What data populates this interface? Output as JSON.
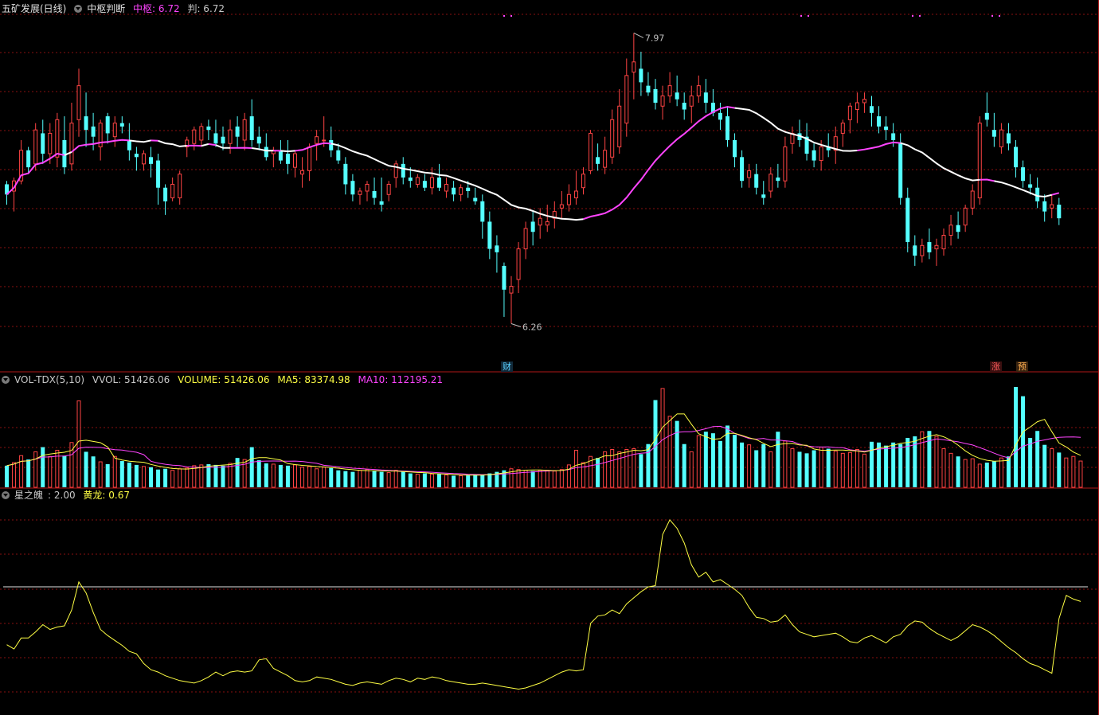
{
  "panel_price": {
    "title": "五矿发展(日线)",
    "indicator": "中枢判断",
    "mid_label": "中枢: 6.72",
    "judge_label": "判: 6.72",
    "high_label": "7.97",
    "low_label": "6.26",
    "markers": [
      "财",
      "涨",
      "预"
    ]
  },
  "panel_volume": {
    "name": "VOL-TDX(5,10)",
    "vvol": "VVOL: 51426.06",
    "volume": "VOLUME: 51426.06",
    "ma5": "MA5: 83374.98",
    "ma10": "MA10: 112195.21"
  },
  "panel_osc": {
    "name": "星之魄",
    "value": ": 2.00",
    "yellow_label": "黄龙: 0.67"
  },
  "colors": {
    "up": "#ff4444",
    "down": "#54ffff",
    "ma_white": "#ffffff",
    "ma_magenta": "#ff44ff",
    "ma_yellow": "#ffff44",
    "grid": "#8a1010"
  },
  "chart_data": [
    {
      "type": "candlestick",
      "title": "五矿发展(日线)",
      "yrange": [
        6.0,
        8.08
      ],
      "high": 7.97,
      "low": 6.26,
      "candles": [
        [
          7.08,
          7.1,
          6.96,
          7.02
        ],
        [
          7.04,
          7.12,
          6.92,
          7.1
        ],
        [
          7.1,
          7.34,
          7.08,
          7.28
        ],
        [
          7.28,
          7.3,
          7.14,
          7.18
        ],
        [
          7.2,
          7.44,
          7.16,
          7.4
        ],
        [
          7.38,
          7.46,
          7.2,
          7.26
        ],
        [
          7.26,
          7.44,
          7.2,
          7.38
        ],
        [
          7.24,
          7.5,
          7.18,
          7.46
        ],
        [
          7.34,
          7.48,
          7.14,
          7.18
        ],
        [
          7.2,
          7.56,
          7.16,
          7.44
        ],
        [
          7.46,
          7.76,
          7.36,
          7.66
        ],
        [
          7.48,
          7.62,
          7.3,
          7.4
        ],
        [
          7.42,
          7.5,
          7.28,
          7.36
        ],
        [
          7.3,
          7.46,
          7.22,
          7.44
        ],
        [
          7.48,
          7.5,
          7.32,
          7.38
        ],
        [
          7.36,
          7.48,
          7.3,
          7.44
        ],
        [
          7.44,
          7.48,
          7.38,
          7.42
        ],
        [
          7.34,
          7.44,
          7.22,
          7.28
        ],
        [
          7.26,
          7.3,
          7.16,
          7.24
        ],
        [
          7.2,
          7.28,
          7.16,
          7.26
        ],
        [
          7.24,
          7.3,
          7.12,
          7.2
        ],
        [
          7.22,
          7.26,
          6.96,
          7.06
        ],
        [
          7.06,
          7.08,
          6.9,
          6.98
        ],
        [
          7.0,
          7.12,
          6.98,
          7.08
        ],
        [
          7.0,
          7.16,
          6.96,
          7.14
        ],
        [
          7.3,
          7.36,
          7.24,
          7.34
        ],
        [
          7.32,
          7.42,
          7.28,
          7.4
        ],
        [
          7.34,
          7.44,
          7.3,
          7.42
        ],
        [
          7.42,
          7.46,
          7.34,
          7.4
        ],
        [
          7.38,
          7.46,
          7.3,
          7.32
        ],
        [
          7.36,
          7.42,
          7.28,
          7.32
        ],
        [
          7.32,
          7.46,
          7.26,
          7.4
        ],
        [
          7.42,
          7.48,
          7.3,
          7.36
        ],
        [
          7.34,
          7.5,
          7.28,
          7.46
        ],
        [
          7.48,
          7.58,
          7.3,
          7.34
        ],
        [
          7.36,
          7.42,
          7.28,
          7.32
        ],
        [
          7.3,
          7.38,
          7.22,
          7.24
        ],
        [
          7.26,
          7.3,
          7.18,
          7.28
        ],
        [
          7.28,
          7.34,
          7.2,
          7.22
        ],
        [
          7.26,
          7.34,
          7.14,
          7.2
        ],
        [
          7.18,
          7.28,
          7.12,
          7.26
        ],
        [
          7.14,
          7.24,
          7.06,
          7.16
        ],
        [
          7.16,
          7.32,
          7.1,
          7.3
        ],
        [
          7.32,
          7.4,
          7.22,
          7.36
        ],
        [
          7.34,
          7.48,
          7.3,
          7.34
        ],
        [
          7.34,
          7.42,
          7.24,
          7.28
        ],
        [
          7.28,
          7.32,
          7.2,
          7.22
        ],
        [
          7.2,
          7.24,
          7.02,
          7.08
        ],
        [
          7.1,
          7.14,
          6.98,
          7.02
        ],
        [
          7.02,
          7.06,
          6.96,
          7.04
        ],
        [
          7.04,
          7.1,
          6.98,
          7.08
        ],
        [
          7.04,
          7.12,
          6.96,
          7.0
        ],
        [
          6.98,
          7.12,
          6.92,
          6.96
        ],
        [
          7.02,
          7.1,
          6.98,
          7.08
        ],
        [
          7.12,
          7.22,
          7.06,
          7.2
        ],
        [
          7.2,
          7.24,
          7.08,
          7.12
        ],
        [
          7.12,
          7.18,
          7.06,
          7.1
        ],
        [
          7.08,
          7.14,
          7.06,
          7.12
        ],
        [
          7.1,
          7.14,
          7.04,
          7.06
        ],
        [
          7.06,
          7.18,
          7.02,
          7.12
        ],
        [
          7.12,
          7.2,
          7.04,
          7.06
        ],
        [
          7.04,
          7.12,
          7.0,
          7.08
        ],
        [
          7.06,
          7.1,
          6.98,
          7.02
        ],
        [
          7.02,
          7.08,
          6.98,
          7.06
        ],
        [
          7.06,
          7.1,
          7.0,
          7.04
        ],
        [
          7.0,
          7.06,
          6.96,
          6.98
        ],
        [
          6.98,
          7.02,
          6.76,
          6.86
        ],
        [
          6.86,
          6.92,
          6.64,
          6.7
        ],
        [
          6.72,
          6.78,
          6.56,
          6.68
        ],
        [
          6.6,
          6.62,
          6.3,
          6.46
        ],
        [
          6.44,
          6.54,
          6.26,
          6.48
        ],
        [
          6.52,
          6.74,
          6.44,
          6.7
        ],
        [
          6.7,
          6.86,
          6.64,
          6.82
        ],
        [
          6.86,
          6.92,
          6.72,
          6.8
        ],
        [
          6.84,
          6.94,
          6.76,
          6.88
        ],
        [
          6.84,
          6.96,
          6.8,
          6.86
        ],
        [
          6.88,
          6.98,
          6.82,
          6.92
        ],
        [
          6.94,
          7.04,
          6.88,
          6.96
        ],
        [
          6.96,
          7.08,
          6.92,
          7.02
        ],
        [
          7.0,
          7.16,
          6.96,
          7.04
        ],
        [
          7.06,
          7.18,
          7.02,
          7.14
        ],
        [
          7.16,
          7.4,
          7.14,
          7.38
        ],
        [
          7.24,
          7.32,
          7.16,
          7.2
        ],
        [
          7.18,
          7.36,
          7.14,
          7.28
        ],
        [
          7.24,
          7.52,
          7.2,
          7.46
        ],
        [
          7.3,
          7.64,
          7.26,
          7.54
        ],
        [
          7.44,
          7.82,
          7.36,
          7.72
        ],
        [
          7.74,
          7.97,
          7.58,
          7.8
        ],
        [
          7.76,
          7.86,
          7.6,
          7.68
        ],
        [
          7.66,
          7.74,
          7.6,
          7.62
        ],
        [
          7.64,
          7.7,
          7.52,
          7.56
        ],
        [
          7.54,
          7.66,
          7.46,
          7.6
        ],
        [
          7.6,
          7.74,
          7.56,
          7.66
        ],
        [
          7.62,
          7.72,
          7.54,
          7.58
        ],
        [
          7.56,
          7.62,
          7.46,
          7.52
        ],
        [
          7.54,
          7.66,
          7.44,
          7.6
        ],
        [
          7.6,
          7.72,
          7.56,
          7.66
        ],
        [
          7.62,
          7.7,
          7.5,
          7.56
        ],
        [
          7.56,
          7.64,
          7.48,
          7.5
        ],
        [
          7.5,
          7.56,
          7.4,
          7.46
        ],
        [
          7.48,
          7.54,
          7.3,
          7.34
        ],
        [
          7.34,
          7.38,
          7.18,
          7.24
        ],
        [
          7.24,
          7.28,
          7.06,
          7.1
        ],
        [
          7.12,
          7.2,
          7.06,
          7.16
        ],
        [
          7.14,
          7.2,
          7.02,
          7.06
        ],
        [
          7.02,
          7.1,
          6.96,
          7.0
        ],
        [
          7.04,
          7.18,
          7.0,
          7.14
        ],
        [
          7.12,
          7.2,
          7.06,
          7.1
        ],
        [
          7.1,
          7.36,
          7.06,
          7.3
        ],
        [
          7.32,
          7.42,
          7.26,
          7.38
        ],
        [
          7.38,
          7.46,
          7.3,
          7.34
        ],
        [
          7.36,
          7.44,
          7.22,
          7.26
        ],
        [
          7.28,
          7.32,
          7.18,
          7.22
        ],
        [
          7.22,
          7.34,
          7.16,
          7.3
        ],
        [
          7.3,
          7.38,
          7.24,
          7.28
        ],
        [
          7.28,
          7.42,
          7.2,
          7.36
        ],
        [
          7.38,
          7.46,
          7.3,
          7.44
        ],
        [
          7.46,
          7.56,
          7.38,
          7.54
        ],
        [
          7.52,
          7.62,
          7.44,
          7.56
        ],
        [
          7.56,
          7.62,
          7.5,
          7.58
        ],
        [
          7.54,
          7.6,
          7.42,
          7.5
        ],
        [
          7.48,
          7.54,
          7.38,
          7.42
        ],
        [
          7.42,
          7.48,
          7.34,
          7.4
        ],
        [
          7.38,
          7.44,
          7.3,
          7.34
        ],
        [
          7.32,
          7.38,
          6.96,
          7.0
        ],
        [
          7.0,
          7.06,
          6.68,
          6.74
        ],
        [
          6.72,
          6.78,
          6.6,
          6.66
        ],
        [
          6.66,
          6.76,
          6.62,
          6.72
        ],
        [
          6.74,
          6.82,
          6.64,
          6.68
        ],
        [
          6.7,
          6.76,
          6.6,
          6.72
        ],
        [
          6.7,
          6.82,
          6.66,
          6.78
        ],
        [
          6.78,
          6.9,
          6.72,
          6.84
        ],
        [
          6.84,
          6.92,
          6.76,
          6.8
        ],
        [
          6.84,
          6.96,
          6.8,
          6.94
        ],
        [
          6.94,
          7.08,
          6.9,
          7.04
        ],
        [
          7.0,
          7.48,
          6.96,
          7.44
        ],
        [
          7.5,
          7.62,
          7.42,
          7.46
        ],
        [
          7.4,
          7.5,
          7.3,
          7.36
        ],
        [
          7.3,
          7.44,
          7.26,
          7.4
        ],
        [
          7.38,
          7.44,
          7.28,
          7.32
        ],
        [
          7.3,
          7.34,
          7.12,
          7.18
        ],
        [
          7.18,
          7.22,
          7.06,
          7.1
        ],
        [
          7.08,
          7.14,
          7.02,
          7.06
        ],
        [
          7.06,
          7.12,
          6.94,
          6.98
        ],
        [
          6.98,
          7.02,
          6.86,
          6.92
        ],
        [
          6.94,
          7.02,
          6.88,
          6.96
        ],
        [
          6.96,
          7.0,
          6.84,
          6.88
        ]
      ]
    },
    {
      "type": "bar",
      "title": "VOL-TDX(5,10)",
      "ylim": [
        0,
        130000
      ],
      "values": [
        28000,
        32000,
        41000,
        36000,
        46000,
        52000,
        40000,
        48000,
        41000,
        58000,
        112000,
        46000,
        40000,
        33000,
        30000,
        40000,
        34000,
        32000,
        29000,
        27000,
        26000,
        23000,
        24000,
        22000,
        24000,
        25000,
        28000,
        29000,
        30000,
        29000,
        28000,
        31000,
        38000,
        36000,
        52000,
        35000,
        31000,
        30000,
        29000,
        28000,
        29000,
        26000,
        27000,
        24000,
        26000,
        25000,
        22000,
        21000,
        20000,
        22000,
        23000,
        21000,
        20000,
        19000,
        22000,
        20000,
        18000,
        17000,
        18000,
        17000,
        17000,
        16000,
        15000,
        15000,
        16000,
        17000,
        16000,
        18000,
        20000,
        22000,
        24000,
        23000,
        22000,
        21000,
        22000,
        22000,
        21000,
        23000,
        29000,
        48000,
        32000,
        40000,
        38000,
        46000,
        49000,
        46000,
        49000,
        50000,
        43000,
        56000,
        113000,
        128000,
        92000,
        86000,
        56000,
        46000,
        67000,
        72000,
        70000,
        60000,
        80000,
        68000,
        58000,
        55000,
        48000,
        56000,
        46000,
        72000,
        60000,
        50000,
        46000,
        44000,
        48000,
        52000,
        50000,
        47000,
        44000,
        45000,
        49000,
        43000,
        59000,
        58000,
        54000,
        58000,
        56000,
        64000,
        66000,
        72000,
        73000,
        66000,
        50000,
        44000,
        40000,
        36000,
        37000,
        30000,
        32000,
        34000,
        38000,
        40000,
        130000,
        118000,
        64000,
        73000,
        55000,
        50000,
        45000,
        38000,
        40000,
        34000
      ],
      "series": [
        {
          "name": "MA5",
          "color": "#ffff44"
        },
        {
          "name": "MA10",
          "color": "#ff44ff"
        }
      ]
    },
    {
      "type": "line",
      "title": "星之魄",
      "ylim": [
        0,
        3.4
      ],
      "reference_line": 2.0,
      "values": [
        1.05,
        0.98,
        1.16,
        1.16,
        1.26,
        1.38,
        1.3,
        1.34,
        1.36,
        1.62,
        2.08,
        1.9,
        1.58,
        1.3,
        1.2,
        1.12,
        1.04,
        0.94,
        0.9,
        0.74,
        0.64,
        0.6,
        0.54,
        0.5,
        0.46,
        0.44,
        0.42,
        0.46,
        0.52,
        0.6,
        0.54,
        0.6,
        0.62,
        0.6,
        0.62,
        0.8,
        0.82,
        0.66,
        0.6,
        0.54,
        0.46,
        0.44,
        0.46,
        0.52,
        0.5,
        0.48,
        0.44,
        0.4,
        0.38,
        0.42,
        0.44,
        0.42,
        0.4,
        0.46,
        0.5,
        0.48,
        0.44,
        0.5,
        0.48,
        0.52,
        0.5,
        0.46,
        0.44,
        0.42,
        0.4,
        0.4,
        0.42,
        0.4,
        0.38,
        0.36,
        0.34,
        0.32,
        0.34,
        0.38,
        0.42,
        0.48,
        0.54,
        0.6,
        0.64,
        0.62,
        0.64,
        1.4,
        1.52,
        1.54,
        1.62,
        1.56,
        1.72,
        1.82,
        1.92,
        2.0,
        2.02,
        2.86,
        3.1,
        2.96,
        2.72,
        2.36,
        2.16,
        2.24,
        2.08,
        2.12,
        2.04,
        1.96,
        1.86,
        1.66,
        1.5,
        1.48,
        1.42,
        1.44,
        1.54,
        1.38,
        1.26,
        1.22,
        1.18,
        1.2,
        1.22,
        1.24,
        1.18,
        1.1,
        1.08,
        1.16,
        1.2,
        1.14,
        1.08,
        1.18,
        1.22,
        1.36,
        1.44,
        1.42,
        1.32,
        1.24,
        1.18,
        1.12,
        1.18,
        1.28,
        1.38,
        1.34,
        1.28,
        1.2,
        1.1,
        1.0,
        0.92,
        0.82,
        0.74,
        0.7,
        0.64,
        0.58,
        1.48,
        1.86,
        1.8,
        1.76
      ]
    }
  ]
}
